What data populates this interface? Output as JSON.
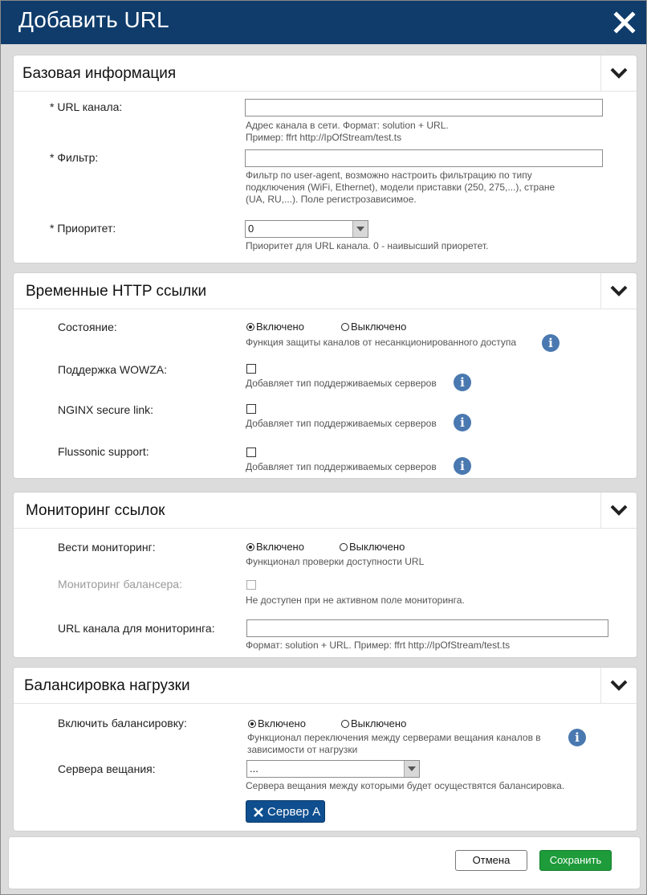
{
  "dialog": {
    "title": "Добавить URL"
  },
  "sections": {
    "basic": {
      "title": "Базовая информация",
      "url_label": "* URL канала:",
      "url_value": "",
      "url_hint1": "Адрес канала в сети. Формат: solution + URL.",
      "url_hint2": "Пример: ffrt http://IpOfStream/test.ts",
      "filter_label": "* Фильтр:",
      "filter_value": "",
      "filter_hint1": "Фильтр по user-agent, возможно настроить фильтрацию по типу",
      "filter_hint2": "подключения (WiFi, Ethernet), модели приставки (250, 275,...), стране",
      "filter_hint3": "(UA, RU,...). Поле регистрозависимое.",
      "priority_label": "* Приоритет:",
      "priority_value": "0",
      "priority_hint": "Приоритет для URL канала. 0 - наивысший приоретет."
    },
    "http": {
      "title": "Временные HTTP ссылки",
      "state_label": "Состояние:",
      "on": "Включено",
      "off": "Выключено",
      "state_selected": "on",
      "state_hint": "Функция защиты каналов от несанкционированного доступа",
      "wowza_label": "Поддержка WOWZA:",
      "wowza_hint": "Добавляет тип поддерживаемых серверов",
      "wowza_checked": false,
      "nginx_label": "NGINX secure link:",
      "nginx_hint": "Добавляет тип поддерживаемых серверов",
      "nginx_checked": false,
      "flussonic_label": "Flussonic support:",
      "flussonic_hint": "Добавляет тип поддерживаемых серверов",
      "flussonic_checked": false
    },
    "monitoring": {
      "title": "Мониторинг ссылок",
      "monitor_label": "Вести мониторинг:",
      "on": "Включено",
      "off": "Выключено",
      "monitor_selected": "on",
      "monitor_hint": "Функционал проверки доступности URL",
      "balancer_label": "Мониторинг балансера:",
      "balancer_hint": "Не доступен при не активном поле мониторинга.",
      "monitor_url_label": "URL канала для мониторинга:",
      "monitor_url_value": "",
      "monitor_url_hint": "Формат: solution + URL. Пример: ffrt http://IpOfStream/test.ts"
    },
    "balancing": {
      "title": "Балансировка нагрузки",
      "enable_label": "Включить балансировку:",
      "on": "Включено",
      "off": "Выключено",
      "enable_selected": "on",
      "enable_hint1": "Функционал переключения между серверами вещания каналов в",
      "enable_hint2": "зависимости от нагрузки",
      "servers_label": "Сервера вещания:",
      "servers_value": "...",
      "servers_hint": "Сервера вещания между которыми будет осуществятся балансировка.",
      "selected_server": "Сервер А"
    }
  },
  "footer": {
    "cancel": "Отмена",
    "save": "Сохранить"
  },
  "colors": {
    "titlebar": "#0f3c6b",
    "save": "#1e9b3a",
    "info": "#4a78b0",
    "tag": "#0f4f8f"
  }
}
